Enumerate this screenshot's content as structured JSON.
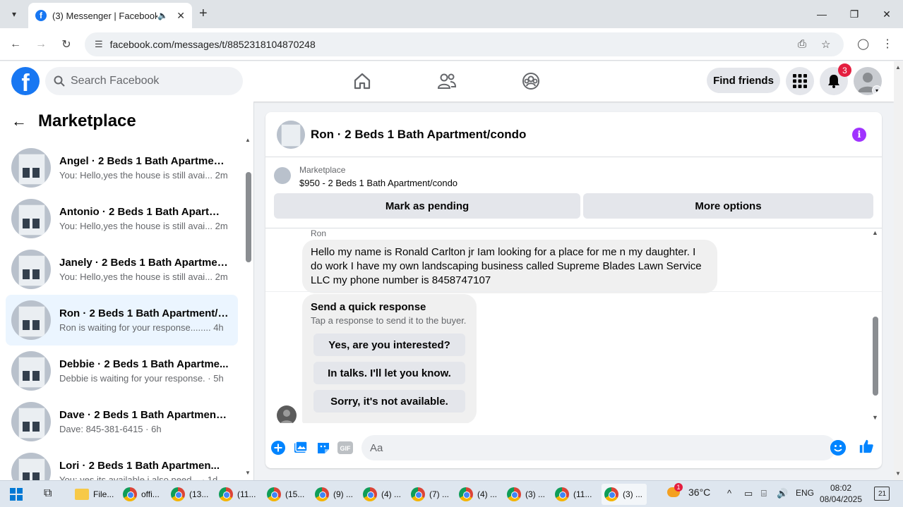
{
  "browser": {
    "tab_title": "(3) Messenger | Facebook",
    "url": "facebook.com/messages/t/8852318104870248",
    "new_tab_icon": "plus-icon"
  },
  "fb": {
    "search_placeholder": "Search Facebook",
    "find_friends": "Find friends",
    "notification_count": "3",
    "logo_letter": "f"
  },
  "sidebar": {
    "title": "Marketplace",
    "conversations": [
      {
        "name": "Angel · 2 Beds 1 Bath Apartment...",
        "preview": "You: Hello,yes the house is still avai... 2m"
      },
      {
        "name": "Antonio · 2 Beds 1 Bath Apartme...",
        "preview": "You: Hello,yes the house is still avai... 2m"
      },
      {
        "name": "Janely · 2 Beds 1 Bath Apartmen...",
        "preview": "You: Hello,yes the house is still avai... 2m"
      },
      {
        "name": "Ron · 2 Beds 1 Bath Apartment/c...",
        "preview": "Ron is waiting for your response........ 4h"
      },
      {
        "name": "Debbie · 2 Beds 1 Bath Apartme...",
        "preview": "Debbie is waiting for your response. · 5h"
      },
      {
        "name": "Dave · 2 Beds 1 Bath Apartment/...",
        "preview": "Dave: 845-381-6415 · 6h"
      },
      {
        "name": "Lori · 2 Beds 1 Bath Apartmen...",
        "preview": "You: yes its available i also need... · 1d"
      }
    ]
  },
  "chat": {
    "title": "Ron · 2 Beds 1 Bath Apartment/condo",
    "listing_source": "Marketplace",
    "listing_price": "$950 - 2 Beds 1 Bath Apartment/condo",
    "mark_pending": "Mark as pending",
    "more_options": "More options",
    "sender": "Ron",
    "message": "Hello my name is Ronald Carlton jr Iam looking for a place for me n my daughter. I do work I have my own landscaping business called Supreme Blades Lawn Service LLC my phone number is 8458747107",
    "quick_title": "Send a quick response",
    "quick_sub": "Tap a response to send it to the buyer.",
    "quick_responses": [
      "Yes, are you interested?",
      "In talks. I'll let you know.",
      "Sorry, it's not available."
    ],
    "composer_placeholder": "Aa",
    "gif_label": "GIF"
  },
  "taskbar": {
    "items": [
      "File...",
      "offi...",
      "(13...",
      "(11...",
      "(15...",
      "(9) ...",
      "(4) ...",
      "(7) ...",
      "(4) ...",
      "(3) ...",
      "(11...",
      "(3) ..."
    ],
    "weather_badge": "1",
    "temperature": "36°C",
    "lang": "ENG",
    "time": "08:02",
    "date": "08/04/2025",
    "notif_count": "21"
  },
  "colors": {
    "fb_blue": "#1877f2",
    "messenger_blue": "#0084ff",
    "info_purple": "#a033ff",
    "badge_red": "#e41e3f"
  }
}
